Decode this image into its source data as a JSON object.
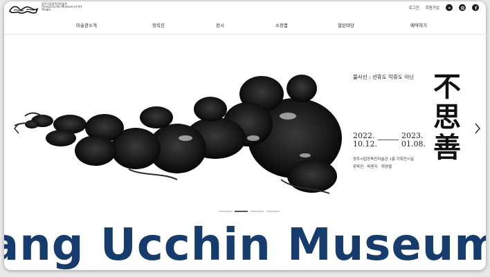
{
  "header": {
    "logo": {
      "korean_name": "양주시립장욱진미술관",
      "english_name": "Chang Ucchin Museum of Art",
      "city": "Yangju"
    },
    "utils": {
      "login": "로그인",
      "signup": "회원가입",
      "sns": [
        "youtube-icon",
        "instagram-icon",
        "facebook-icon"
      ]
    },
    "nav": [
      "미술관소개",
      "장욱진",
      "전시",
      "소장품",
      "열린마당",
      "예약하기"
    ]
  },
  "hero": {
    "subtitle": "불사선 : 선휴도 악휴도 아닌",
    "title_chars": [
      "不",
      "思",
      "善"
    ],
    "date_start": "2022.\n10.12.",
    "date_end": "2023.\n01.08.",
    "venue_line1": "양주시립장욱진미술관 1층 기획전시실",
    "venue_line2": "장욱진 · 파덴지 · 최양렬",
    "slide_count": 4,
    "active_slide": 1
  },
  "marquee": {
    "text": "ang Ucchin Museum of"
  },
  "colors": {
    "marquee": "#163b6d",
    "ink": "#1a1a1a"
  }
}
